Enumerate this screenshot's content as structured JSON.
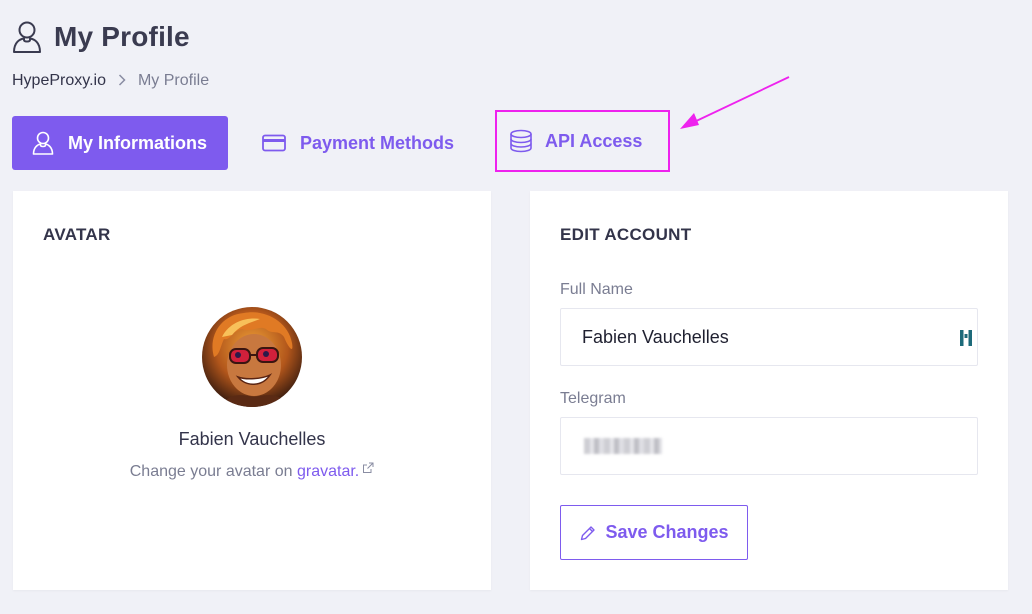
{
  "header": {
    "title": "My Profile",
    "icon": "user-icon"
  },
  "breadcrumb": {
    "root": "HypeProxy.io",
    "separator": ">",
    "current": "My Profile"
  },
  "tabs": [
    {
      "label": "My Informations",
      "icon": "user-icon",
      "active": true
    },
    {
      "label": "Payment Methods",
      "icon": "credit-card-icon",
      "active": false
    },
    {
      "label": "API Access",
      "icon": "database-icon",
      "active": false,
      "highlighted": true
    }
  ],
  "avatar_card": {
    "title": "AVATAR",
    "name": "Fabien Vauchelles",
    "hint_prefix": "Change your avatar on ",
    "hint_link": "gravatar.",
    "hint_link_icon": "external-link-icon"
  },
  "account_card": {
    "title": "EDIT ACCOUNT",
    "full_name_label": "Full Name",
    "full_name_value": "Fabien Vauchelles",
    "telegram_label": "Telegram",
    "telegram_value_redacted": true,
    "save_label": "Save Changes",
    "save_icon": "pencil-icon"
  },
  "colors": {
    "accent": "#7e5bee",
    "highlight": "#ee22ee",
    "background": "#f0f1f7"
  }
}
